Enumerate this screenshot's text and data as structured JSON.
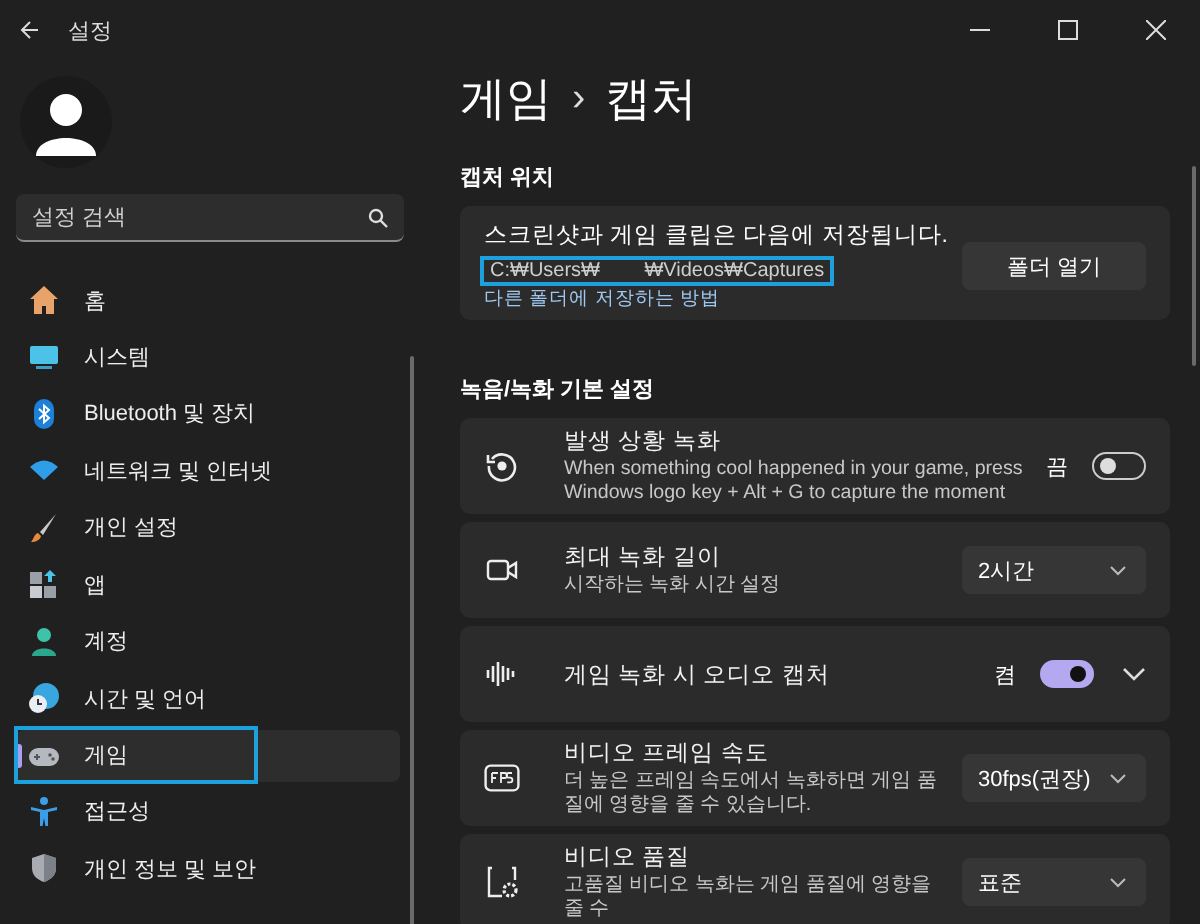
{
  "window": {
    "title": "설정"
  },
  "sidebar": {
    "search": {
      "placeholder": "설정 검색"
    },
    "items": [
      {
        "label": "홈",
        "selected": false,
        "highlighted": false
      },
      {
        "label": "시스템",
        "selected": false,
        "highlighted": false
      },
      {
        "label": "Bluetooth 및 장치",
        "selected": false,
        "highlighted": false
      },
      {
        "label": "네트워크 및 인터넷",
        "selected": false,
        "highlighted": false
      },
      {
        "label": "개인 설정",
        "selected": false,
        "highlighted": false
      },
      {
        "label": "앱",
        "selected": false,
        "highlighted": false
      },
      {
        "label": "계정",
        "selected": false,
        "highlighted": false
      },
      {
        "label": "시간 및 언어",
        "selected": false,
        "highlighted": false
      },
      {
        "label": "게임",
        "selected": true,
        "highlighted": true
      },
      {
        "label": "접근성",
        "selected": false,
        "highlighted": false
      },
      {
        "label": "개인 정보 및 보안",
        "selected": false,
        "highlighted": false
      }
    ]
  },
  "breadcrumb": {
    "parent": "게임",
    "separator": "›",
    "current": "캡처"
  },
  "capture_location": {
    "heading": "캡처 위치",
    "message": "스크린샷과 게임 클립은 다음에 저장됩니다.",
    "path": {
      "text": "C:₩Users₩        ₩Videos₩Captures",
      "highlighted": true
    },
    "link": "다른 폴더에 저장하는 방법",
    "button": "폴더 열기"
  },
  "recording": {
    "heading": "녹음/녹화 기본 설정",
    "rows": [
      {
        "kind": "toggle",
        "title": "발생 상황 녹화",
        "description": "When something cool happened in your game, press Windows logo key + Alt + G to capture the moment",
        "state_label": "끔",
        "on": false,
        "expandable": false
      },
      {
        "kind": "dropdown",
        "title": "최대 녹화 길이",
        "description": "시작하는 녹화 시간 설정",
        "value": "2시간"
      },
      {
        "kind": "toggle",
        "title": "게임 녹화 시 오디오 캡처",
        "state_label": "켬",
        "on": true,
        "expandable": true
      },
      {
        "kind": "dropdown",
        "title": "비디오 프레임 속도",
        "description": "더 높은 프레임 속도에서 녹화하면 게임 품질에 영향을 줄 수 있습니다.",
        "value": "30fps(권장)"
      },
      {
        "kind": "dropdown",
        "title": "비디오 품질",
        "description": "고품질 비디오 녹화는 게임 품질에 영향을 줄 수",
        "value": "표준"
      }
    ]
  }
}
